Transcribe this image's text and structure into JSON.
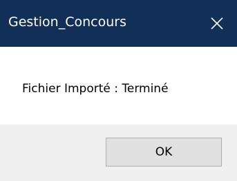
{
  "window": {
    "title": "Gestion_Concours",
    "close_icon": "close-icon",
    "colors": {
      "titlebar": "#122f57",
      "titlebar_text": "#ffffff",
      "content_bg": "#ffffff",
      "button_area_bg": "#f0f0f0",
      "button_bg": "#e1e1e1",
      "button_border": "#adadad"
    }
  },
  "message": {
    "text": "Fichier Importé : Terminé"
  },
  "buttons": {
    "ok_label": "OK"
  }
}
